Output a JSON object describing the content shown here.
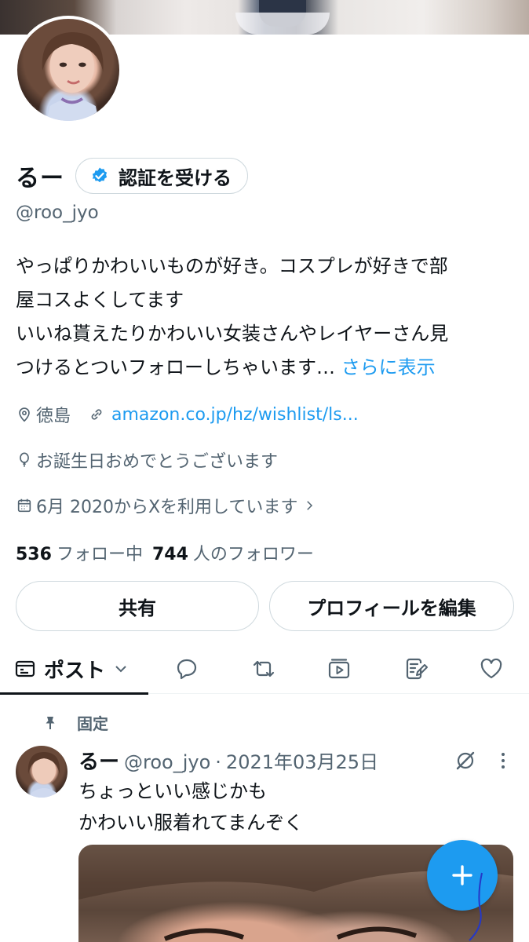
{
  "profile": {
    "display_name": "るー",
    "verify_label": "認証を受ける",
    "handle": "@roo_jyo",
    "bio_line1": "やっぱりかわいいものが好き。コスプレが好きで部",
    "bio_line2": "屋コスよくしてます",
    "bio_line3": "いいね貰えたりかわいい女装さんやレイヤーさん見",
    "bio_line4": "つけるとついフォローしちゃいます…",
    "bio_more": "さらに表示",
    "location": "徳島",
    "website": "amazon.co.jp/hz/wishlist/ls...",
    "birthday": "お誕生日おめでとうございます",
    "joined": "6月 2020からXを利用しています",
    "following_count": "536",
    "following_label": "フォロー中",
    "followers_count": "744",
    "followers_label": "人のフォロワー"
  },
  "actions": {
    "share_label": "共有",
    "edit_label": "プロフィールを編集"
  },
  "tabs": {
    "posts_label": "ポスト"
  },
  "pinned_post": {
    "pinned_label": "固定",
    "author_name": "るー",
    "author_handle": "@roo_jyo",
    "separator": "·",
    "date": "2021年03月25日",
    "text_line1": "ちょっといい感じかも",
    "text_line2": "かわいい服着れてまんぞく"
  },
  "colors": {
    "accent": "#1d9bf0",
    "text_primary": "#0f1419",
    "text_secondary": "#536471",
    "border": "#cfd9de"
  },
  "icons": {
    "verified": "verified-badge-icon",
    "location": "location-pin-icon",
    "link": "link-icon",
    "birthday": "balloon-icon",
    "calendar": "calendar-icon",
    "posts_tab": "posts-icon",
    "replies_tab": "reply-icon",
    "reposts_tab": "repost-icon",
    "media_tab": "media-icon",
    "articles_tab": "articles-icon",
    "likes_tab": "heart-icon",
    "pin": "pin-icon",
    "grok": "grok-icon",
    "more": "more-icon",
    "compose": "plus-icon"
  }
}
